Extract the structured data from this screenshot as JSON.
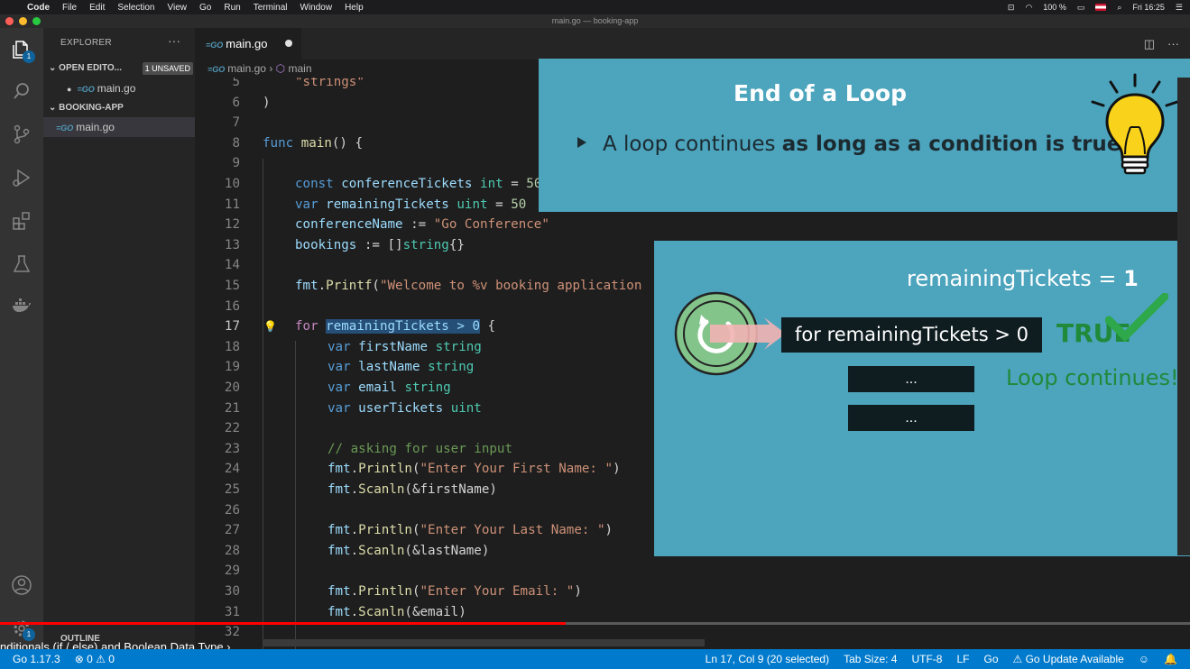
{
  "menubar": {
    "app_name": "Code",
    "items": [
      "File",
      "Edit",
      "Selection",
      "View",
      "Go",
      "Run",
      "Terminal",
      "Window",
      "Help"
    ],
    "battery": "100 %",
    "clock": "Fri 16:25"
  },
  "window": {
    "title": "main.go — booking-app"
  },
  "explorer": {
    "header": "EXPLORER",
    "open_editors_label": "OPEN EDITO...",
    "unsaved_badge": "1 UNSAVED",
    "open_file": "main.go",
    "project_label": "BOOKING-APP",
    "project_file": "main.go",
    "outline_label": "OUTLINE",
    "explorer_badge": "1",
    "settings_badge": "1"
  },
  "tab": {
    "file": "main.go"
  },
  "breadcrumb": {
    "file": "main.go",
    "symbol": "main"
  },
  "code": {
    "l5": "\"strings\"",
    "l6": ")",
    "l8_kw": "func",
    "l8_fn": "main",
    "l8_rest": "() {",
    "l10_kw": "const",
    "l10_name": "conferenceTickets",
    "l10_type": "int",
    "l10_rest": " = ",
    "l10_val": "50",
    "l11_kw": "var",
    "l11_name": "remainingTickets",
    "l11_type": "uint",
    "l11_rest": " = ",
    "l11_val": "50",
    "l12_name": "conferenceName",
    "l12_op": " := ",
    "l12_str": "\"Go Conference\"",
    "l13_name": "bookings",
    "l13_op": " := []",
    "l13_type": "string",
    "l13_rest": "{}",
    "l15_pkg": "fmt",
    "l15_fn": "Printf",
    "l15_str": "\"Welcome to %v booking application",
    "l17_kw": "for",
    "l17_sel": "remainingTickets > 0",
    "l17_rest": " {",
    "l18_name": "firstName",
    "l19_name": "lastName",
    "l20_name": "email",
    "l21_name": "userTickets",
    "var_kw": "var",
    "string_type": "string",
    "uint_type": "uint",
    "l23_com": "// asking for user input",
    "println": "Println",
    "scanln": "Scanln",
    "fmt": "fmt",
    "l24_str": "\"Enter Your First Name: \"",
    "l25_arg": "(&firstName)",
    "l27_str": "\"Enter Your Last Name: \"",
    "l28_arg": "(&lastName)",
    "l30_str": "\"Enter Your Email: \"",
    "l31_arg": "(&email)"
  },
  "line_numbers": [
    "5",
    "6",
    "7",
    "8",
    "9",
    "10",
    "11",
    "12",
    "13",
    "14",
    "15",
    "16",
    "17",
    "18",
    "19",
    "20",
    "21",
    "22",
    "23",
    "24",
    "25",
    "26",
    "27",
    "28",
    "29",
    "30",
    "31",
    "32"
  ],
  "slide_top": {
    "title": "End of a Loop",
    "bullet_plain": "A loop continues ",
    "bullet_bold": "as long as a condition is true"
  },
  "slide_bottom": {
    "remaining_label": "remainingTickets = ",
    "remaining_value": "1",
    "loop_code": "for remainingTickets > 0",
    "dots_1": "...",
    "dots_2": "...",
    "true_label": "TRUE",
    "loop_continues": "Loop continues!"
  },
  "video": {
    "caption": "nditionals (if / else) and Boolean Data Type",
    "progress": 0.475
  },
  "statusbar": {
    "go_version": "Go 1.17.3",
    "problems": "⊗ 0 ⚠ 0",
    "cursor": "Ln 17, Col 9 (20 selected)",
    "tab_size": "Tab Size: 4",
    "encoding": "UTF-8",
    "eol": "LF",
    "language": "Go",
    "update": "⚠ Go Update Available"
  },
  "colors": {
    "accent": "#007acc",
    "slide_bg": "#4ca4bd",
    "true_green": "#1f8a3a"
  }
}
